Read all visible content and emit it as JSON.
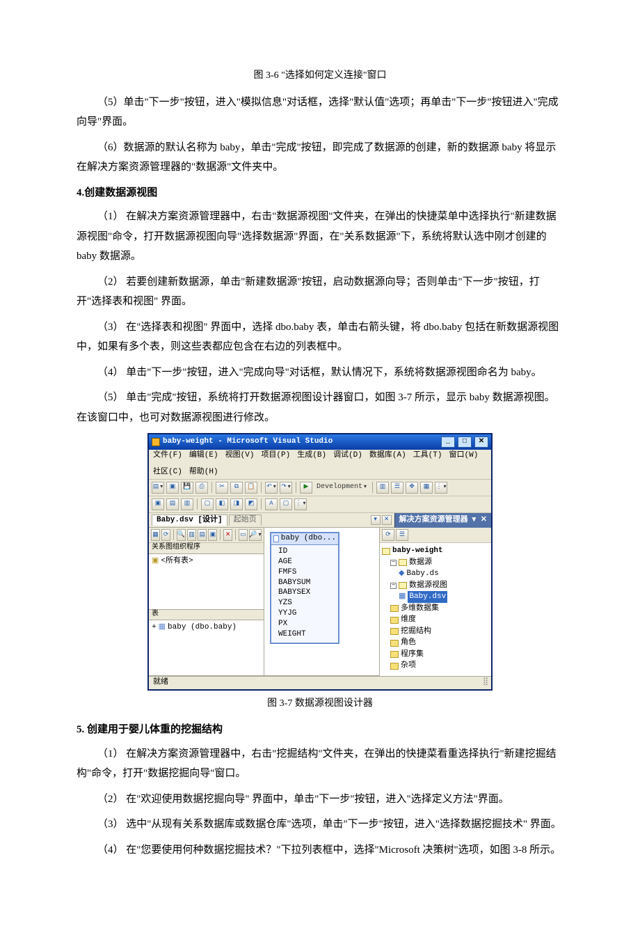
{
  "caption36": "图 3-6  \"选择如何定义连接\"窗口",
  "p5": "（5）单击\"下一步\"按钮，进入\"模拟信息\"对话框，选择\"默认值\"选项；再单击\"下一步\"按钮进入\"完成向导\"界面。",
  "p6": "（6）数据源的默认名称为 baby，单击\"完成\"按钮，即完成了数据源的创建，新的数据源 baby 将显示在解决方案资源管理器的\"数据源\"文件夹中。",
  "sect4": "4.创建数据源视图",
  "s4p1": "（1） 在解决方案资源管理器中，右击\"数据源视图\"文件夹，在弹出的快捷菜单中选择执行\"新建数据源视图\"命令，打开数据源视图向导\"选择数据源\"界面，在\"关系数据源\"下，系统将默认选中刚才创建的 baby 数据源。",
  "s4p2": "（2） 若要创建新数据源，单击\"新建数据源\"按钮，启动数据源向导；否则单击\"下一步\"按钮，打开\"选择表和视图\" 界面。",
  "s4p3": "（3） 在\"选择表和视图\" 界面中，选择 dbo.baby 表，单击右箭头键，将 dbo.baby 包括在新数据源视图中，如果有多个表，则这些表都应包含在右边的列表框中。",
  "s4p4": "（4） 单击\"下一步\"按钮，进入\"完成向导\"对话框，默认情况下，系统将数据源视图命名为 baby。",
  "s4p5": "（5） 单击\"完成\"按钮，系统将打开数据源视图设计器窗口，如图 3-7 所示，显示 baby 数据源视图。在该窗口中，也可对数据源视图进行修改。",
  "caption37": "图 3-7 数据源视图设计器",
  "sect5": "5. 创建用于婴儿体重的挖掘结构",
  "s5p1": "（1） 在解决方案资源管理器中，右击\"挖掘结构\"文件夹，在弹出的快捷菜看重选择执行\"新建挖掘结构\"命令，打开\"数据挖掘向导\"窗口。",
  "s5p2": "（2） 在\"欢迎使用数据挖掘向导\" 界面中，单击\"下一步\"按钮，进入\"选择定义方法\"界面。",
  "s5p3": "（3） 选中\"从现有关系数据库或数据仓库\"选项，单击\"下一步\"按钮，进入\"选择数据挖掘技术\" 界面。",
  "s5p4": "（4） 在\"您要使用何种数据挖掘技术？\"下拉列表框中，选择\"Microsoft 决策树\"选项，如图 3-8 所示。",
  "vs": {
    "title": "baby-weight - Microsoft Visual Studio",
    "menus": [
      "文件(F)",
      "编辑(E)",
      "视图(V)",
      "项目(P)",
      "生成(B)",
      "调试(D)",
      "数据库(A)",
      "工具(T)",
      "窗口(W)",
      "社区(C)",
      "帮助(H)"
    ],
    "config": "Development",
    "tab_active": "Baby.dsv [设计]",
    "tab_inactive": "起始页",
    "org_title": "关系图组织程序",
    "all_tables": "<所有表>",
    "tables_title": "表",
    "table_entry": "baby (dbo.baby)",
    "entity_title": "baby (dbo...",
    "columns": [
      "ID",
      "AGE",
      "FMFS",
      "BABYSUM",
      "BABYSEX",
      "YZS",
      "YYJG",
      "PX",
      "WEIGHT"
    ],
    "solution_title": "解决方案资源管理器",
    "tree": {
      "root": "baby-weight",
      "ds_folder": "数据源",
      "ds_item": "Baby.ds",
      "dsv_folder": "数据源视图",
      "dsv_item": "Baby.dsv",
      "cubes": "多维数据集",
      "dims": "维度",
      "mining": "挖掘结构",
      "roles": "角色",
      "asm": "程序集",
      "misc": "杂项"
    },
    "status": "就绪"
  }
}
